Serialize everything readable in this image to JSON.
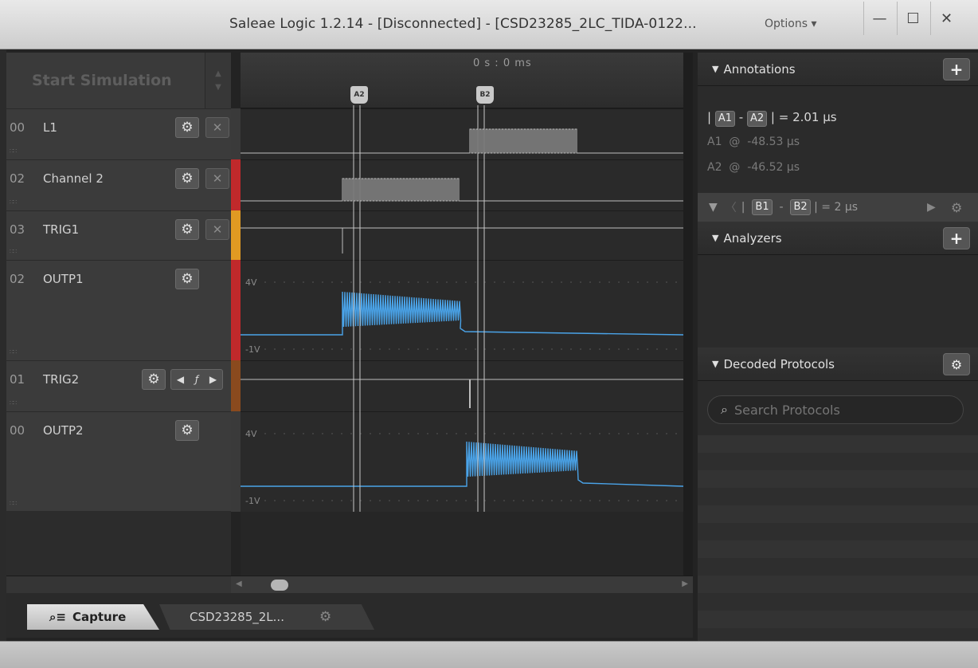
{
  "window": {
    "title": "Saleae Logic 1.2.14 - [Disconnected] - [CSD23285_2LC_TIDA-0122...",
    "options_label": "Options ▾",
    "min_glyph": "—",
    "max_glyph": "☐",
    "close_glyph": "✕"
  },
  "sim_button": {
    "label": "Start Simulation"
  },
  "channels": [
    {
      "index": "00",
      "name": "L1",
      "color": ""
    },
    {
      "index": "02",
      "name": "Channel 2",
      "color": "#c0292b"
    },
    {
      "index": "03",
      "name": "TRIG1",
      "color": "#e19a22"
    },
    {
      "index": "02",
      "name": "OUTP1",
      "color": "#c0292b"
    },
    {
      "index": "01",
      "name": "TRIG2",
      "color": "#8a4a1e"
    },
    {
      "index": "00",
      "name": "OUTP2",
      "color": ""
    }
  ],
  "timeline": {
    "time_label": "0 s : 0 ms",
    "markers": [
      "A2",
      "B2"
    ]
  },
  "analog_scale": {
    "top": "4V",
    "bottom": "-1V"
  },
  "tabs": {
    "capture": "Capture",
    "session": "CSD23285_2L..."
  },
  "annotations": {
    "header": "Annotations",
    "a1": "A1",
    "a2": "A2",
    "a_diff": "| = 2.01 µs",
    "a1_at": "-48.53 µs",
    "a2_at": "-46.52 µs",
    "at_symbol": "@",
    "b1": "B1",
    "b2": "B2",
    "b_diff": "| = 2 µs"
  },
  "analyzers": {
    "header": "Analyzers"
  },
  "decoded_protocols": {
    "header": "Decoded Protocols",
    "search_placeholder": "Search Protocols"
  },
  "colors": {
    "wave_analog": "#4aa3e8",
    "wave_digital": "#bdbdbd"
  }
}
